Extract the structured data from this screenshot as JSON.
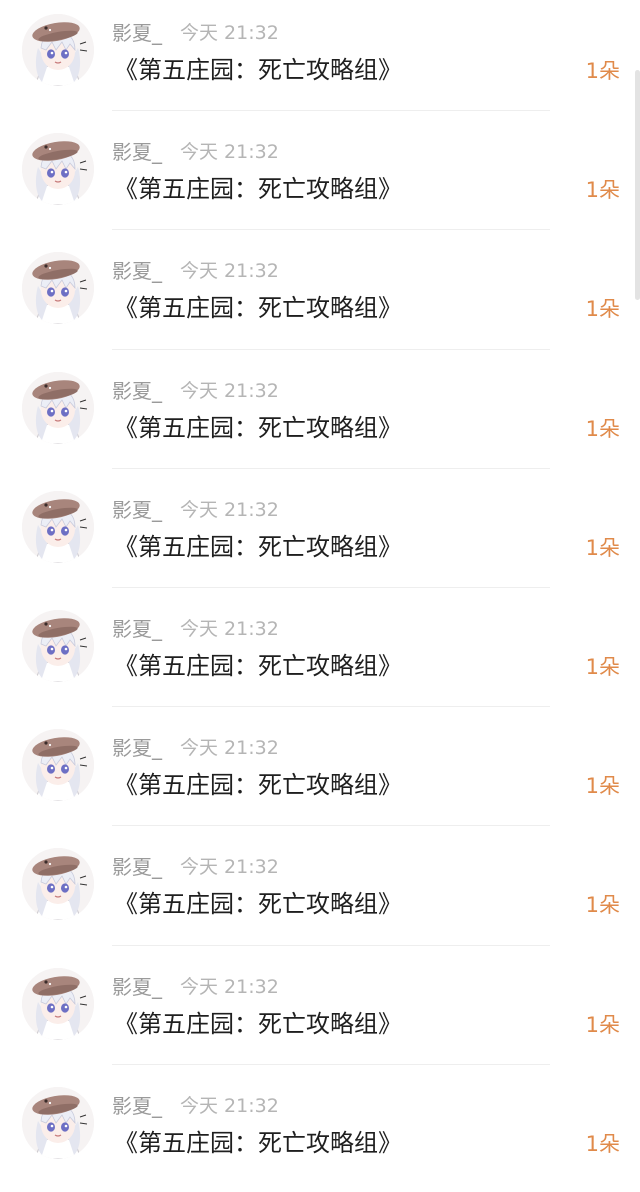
{
  "colors": {
    "username": "#9a9a9a",
    "time": "#b5b5b5",
    "book_title": "#1f1f1f",
    "count": "#e08a4a",
    "divider": "#eeeeee"
  },
  "gifts": [
    {
      "user": "影夏_",
      "time": "今天 21:32",
      "book": "《第五庄园：死亡攻略组》",
      "count": "1朵",
      "avatar": "avatar-icon"
    },
    {
      "user": "影夏_",
      "time": "今天 21:32",
      "book": "《第五庄园：死亡攻略组》",
      "count": "1朵",
      "avatar": "avatar-icon"
    },
    {
      "user": "影夏_",
      "time": "今天 21:32",
      "book": "《第五庄园：死亡攻略组》",
      "count": "1朵",
      "avatar": "avatar-icon"
    },
    {
      "user": "影夏_",
      "time": "今天 21:32",
      "book": "《第五庄园：死亡攻略组》",
      "count": "1朵",
      "avatar": "avatar-icon"
    },
    {
      "user": "影夏_",
      "time": "今天 21:32",
      "book": "《第五庄园：死亡攻略组》",
      "count": "1朵",
      "avatar": "avatar-icon"
    },
    {
      "user": "影夏_",
      "time": "今天 21:32",
      "book": "《第五庄园：死亡攻略组》",
      "count": "1朵",
      "avatar": "avatar-icon"
    },
    {
      "user": "影夏_",
      "time": "今天 21:32",
      "book": "《第五庄园：死亡攻略组》",
      "count": "1朵",
      "avatar": "avatar-icon"
    },
    {
      "user": "影夏_",
      "time": "今天 21:32",
      "book": "《第五庄园：死亡攻略组》",
      "count": "1朵",
      "avatar": "avatar-icon"
    },
    {
      "user": "影夏_",
      "time": "今天 21:32",
      "book": "《第五庄园：死亡攻略组》",
      "count": "1朵",
      "avatar": "avatar-icon"
    },
    {
      "user": "影夏_",
      "time": "今天 21:32",
      "book": "《第五庄园：死亡攻略组》",
      "count": "1朵",
      "avatar": "avatar-icon"
    }
  ]
}
